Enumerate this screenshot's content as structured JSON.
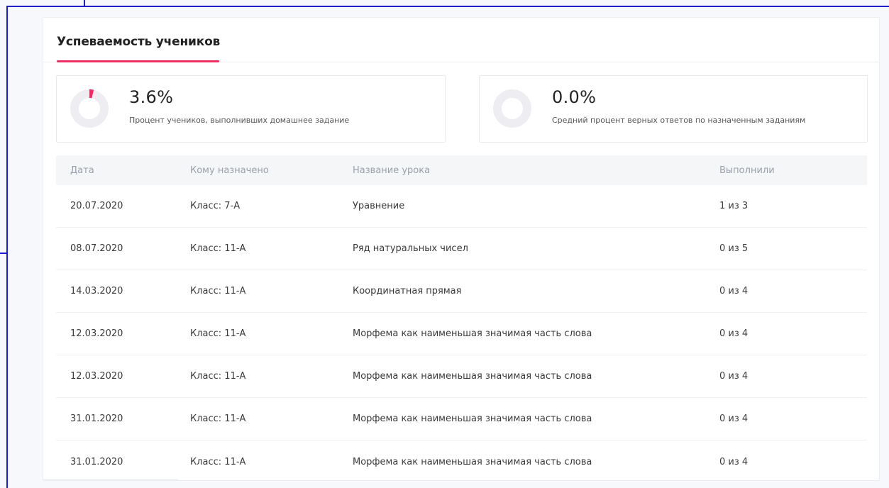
{
  "header": {
    "title": "Успеваемость учеников"
  },
  "stats": [
    {
      "value": "3.6%",
      "fraction": 0.036,
      "label": "Процент учеников, выполнивших домашнее задание"
    },
    {
      "value": "0.0%",
      "fraction": 0.0,
      "label": "Средний процент верных ответов по назначенным заданиям"
    }
  ],
  "table": {
    "columns": [
      "Дата",
      "Кому назначено",
      "Название урока",
      "Выполнили"
    ],
    "rows": [
      [
        "20.07.2020",
        "Класс: 7-А",
        "Уравнение",
        "1 из 3"
      ],
      [
        "08.07.2020",
        "Класс: 11-А",
        "Ряд натуральных чисел",
        "0 из 5"
      ],
      [
        "14.03.2020",
        "Класс: 11-А",
        "Координатная прямая",
        "0 из 4"
      ],
      [
        "12.03.2020",
        "Класс: 11-А",
        "Морфема как наименьшая значимая часть слова",
        "0 из 4"
      ],
      [
        "12.03.2020",
        "Класс: 11-А",
        "Морфема как наименьшая значимая часть слова",
        "0 из 4"
      ],
      [
        "31.01.2020",
        "Класс: 11-А",
        "Морфема как наименьшая значимая часть слова",
        "0 из 4"
      ],
      [
        "31.01.2020",
        "Класс: 11-А",
        "Морфема как наименьшая значимая часть слова",
        "0 из 4"
      ]
    ]
  },
  "colors": {
    "accent": "#ec2e63",
    "donut_track": "#eeeef2",
    "frame": "#1d1fcf"
  }
}
